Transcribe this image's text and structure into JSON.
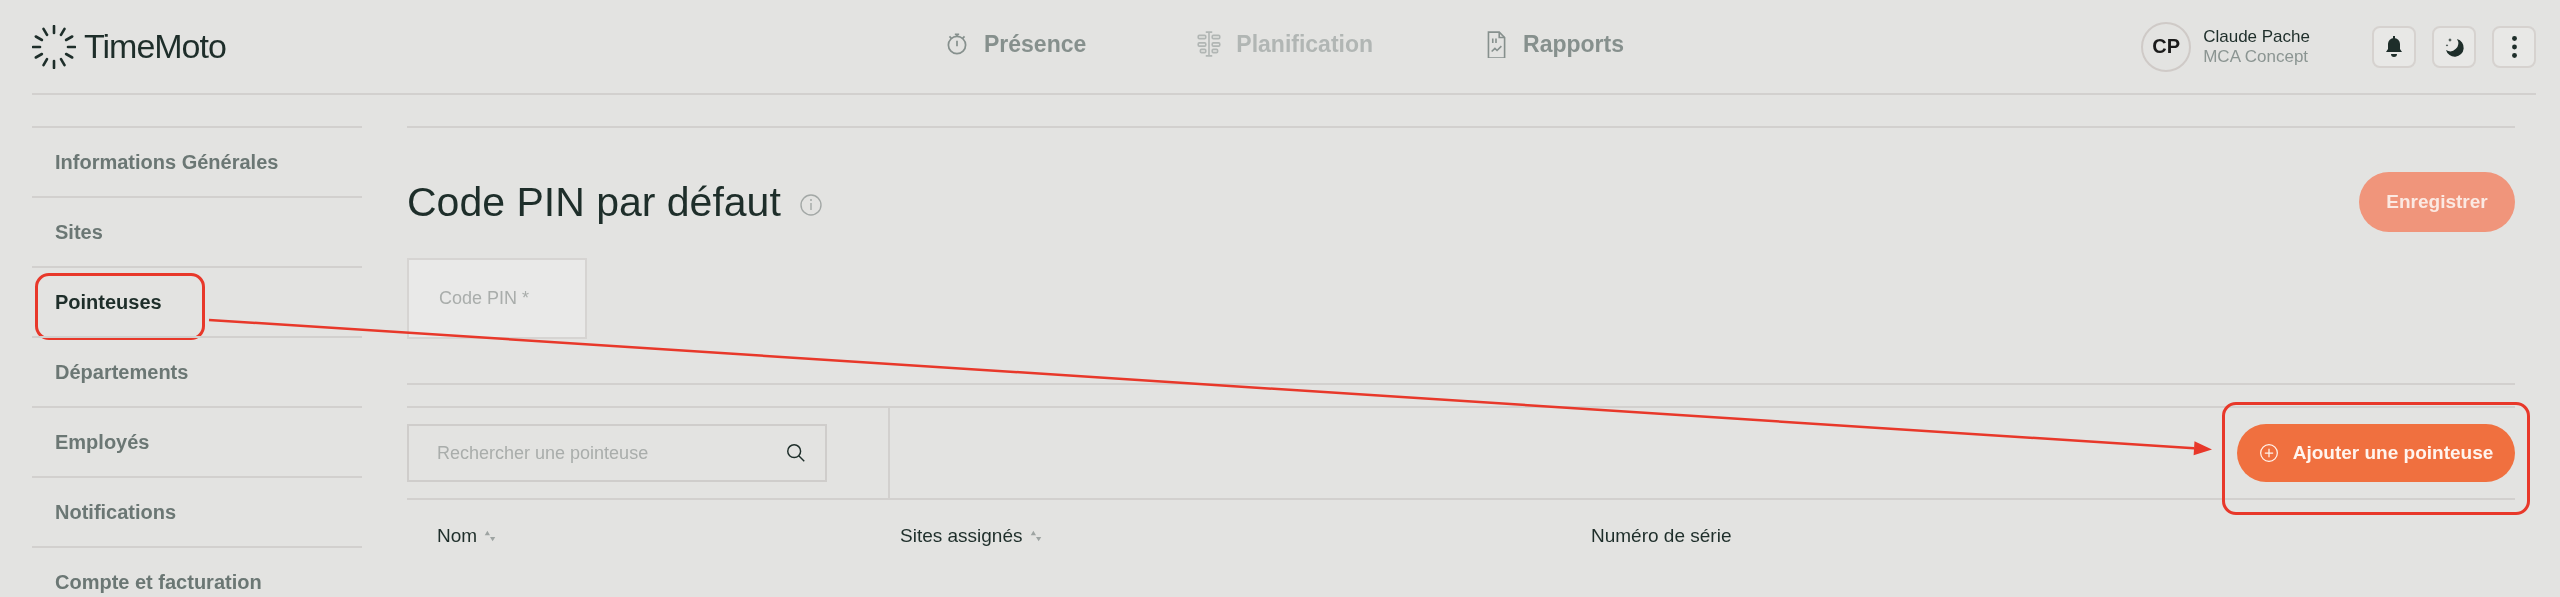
{
  "header": {
    "logo": "TimeMoto",
    "nav": [
      {
        "label": "Présence",
        "disabled": false
      },
      {
        "label": "Planification",
        "disabled": true
      },
      {
        "label": "Rapports",
        "disabled": false
      }
    ],
    "user": {
      "initials": "CP",
      "name": "Claude Pache",
      "company": "MCA Concept"
    }
  },
  "sidebar": {
    "items": [
      {
        "label": "Informations Générales",
        "selected": false,
        "highlighted": false
      },
      {
        "label": "Sites",
        "selected": false,
        "highlighted": false
      },
      {
        "label": "Pointeuses",
        "selected": true,
        "highlighted": true
      },
      {
        "label": "Départements",
        "selected": false,
        "highlighted": false
      },
      {
        "label": "Employés",
        "selected": false,
        "highlighted": false
      },
      {
        "label": "Notifications",
        "selected": false,
        "highlighted": false
      },
      {
        "label": "Compte et facturation",
        "selected": false,
        "highlighted": false
      }
    ]
  },
  "main": {
    "title": "Code PIN par défaut",
    "save_button": "Enregistrer",
    "pin_field": {
      "placeholder": "Code PIN *"
    },
    "search": {
      "placeholder": "Rechercher une pointeuse"
    },
    "add_button": {
      "label": "Ajouter une pointeuse",
      "highlighted": true
    },
    "table": {
      "columns": [
        {
          "label": "Nom",
          "sortable": true
        },
        {
          "label": "Sites assignés",
          "sortable": true
        },
        {
          "label": "Numéro de série",
          "sortable": false
        }
      ]
    }
  },
  "annotation": {
    "arrow": true
  }
}
